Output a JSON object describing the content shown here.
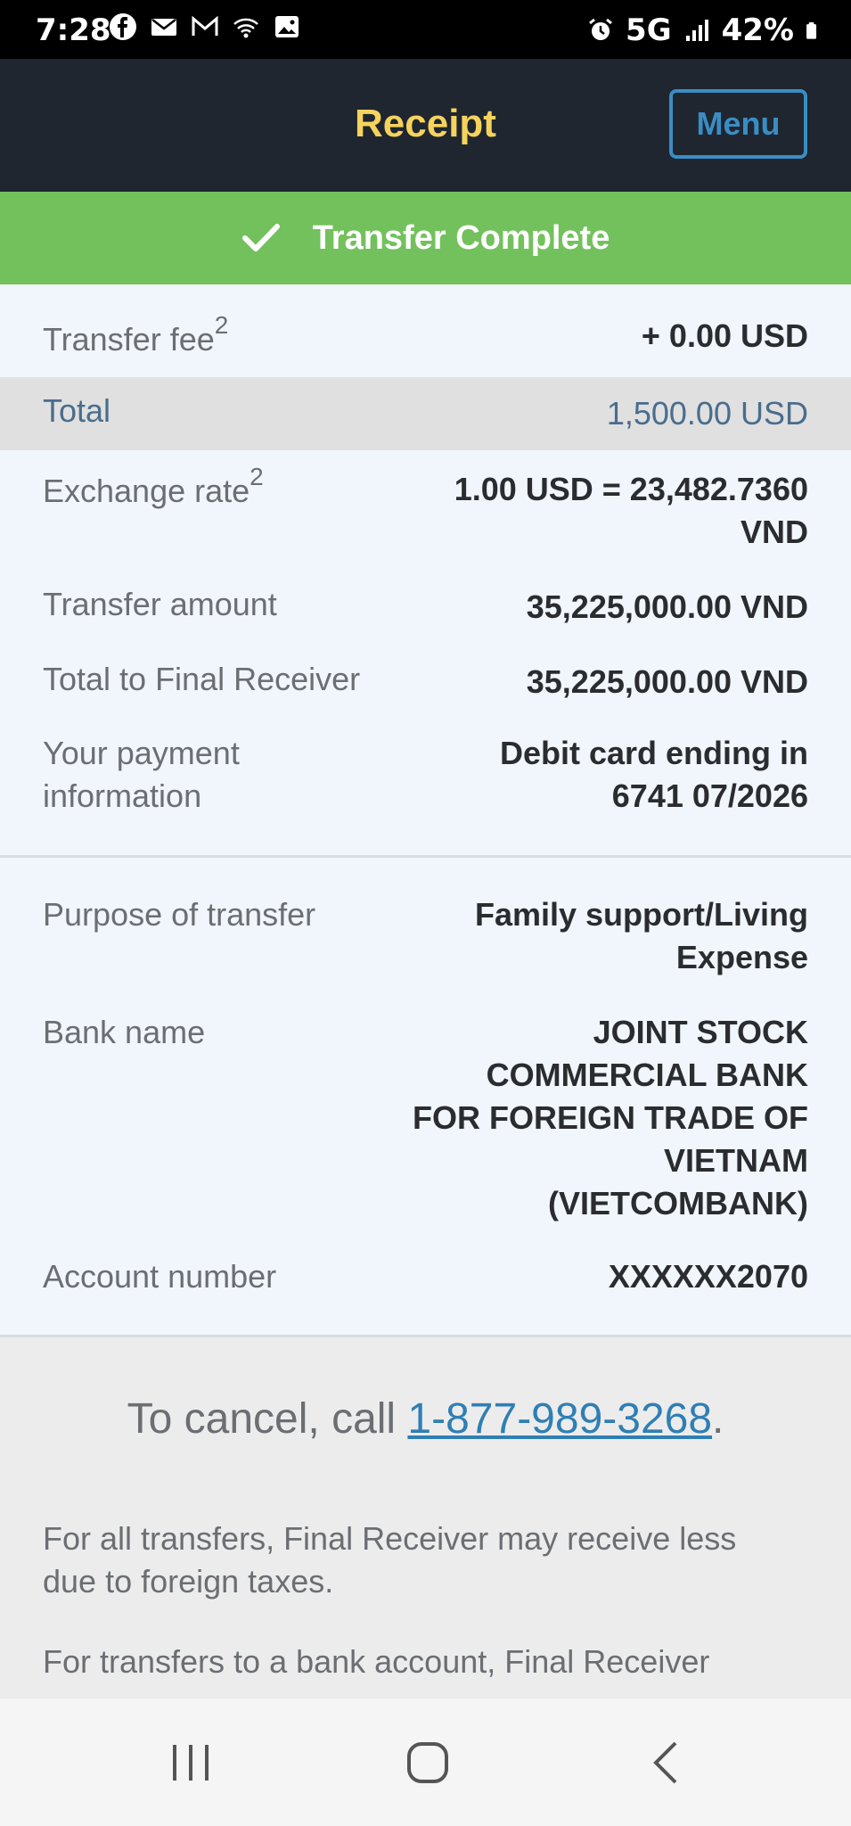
{
  "status_bar": {
    "time": "7:28",
    "network": "5G",
    "battery": "42%"
  },
  "header": {
    "title": "Receipt",
    "menu_label": "Menu"
  },
  "banner": {
    "text": "Transfer Complete"
  },
  "rows": {
    "fee": {
      "label": "Transfer fee",
      "sup": "2",
      "value": "+ 0.00 USD"
    },
    "total": {
      "label": "Total",
      "value": "1,500.00 USD"
    },
    "rate": {
      "label": "Exchange rate",
      "sup": "2",
      "value_line1": "1.00 USD = 23,482.7360",
      "value_line2": "VND"
    },
    "amount": {
      "label": "Transfer amount",
      "value": "35,225,000.00 VND"
    },
    "final": {
      "label": "Total to Final Receiver",
      "value": "35,225,000.00 VND"
    },
    "payment": {
      "label_line1": "Your payment",
      "label_line2": "information",
      "value_line1": "Debit card ending in",
      "value_line2": "6741 07/2026"
    },
    "purpose": {
      "label": "Purpose of transfer",
      "value_line1": "Family support/Living",
      "value_line2": "Expense"
    },
    "bank": {
      "label": "Bank name",
      "value_lines": [
        "JOINT STOCK",
        "COMMERCIAL BANK",
        "FOR FOREIGN TRADE OF",
        "VIETNAM",
        "(VIETCOMBANK)"
      ]
    },
    "account": {
      "label": "Account number",
      "value": "XXXXXX2070"
    }
  },
  "footer": {
    "cancel_prefix": "To cancel, call ",
    "phone": "1-877-989-3268",
    "cancel_suffix": ".",
    "note1_line1": "For all transfers, Final Receiver may receive less",
    "note1_line2": "due to foreign taxes.",
    "note2_line1": "For transfers to a bank account, Final Receiver"
  },
  "colors": {
    "header_bg": "#1f2630",
    "title": "#f5d35d",
    "banner": "#73c15d",
    "accent": "#3a8dc4",
    "link": "#2f7fb4"
  },
  "icons": [
    "facebook-icon",
    "mail-icon",
    "gmail-icon",
    "wifi-icon",
    "image-icon",
    "alarm-icon",
    "signal-icon",
    "battery-icon",
    "check-icon",
    "recent-apps-icon",
    "home-icon",
    "back-icon"
  ]
}
